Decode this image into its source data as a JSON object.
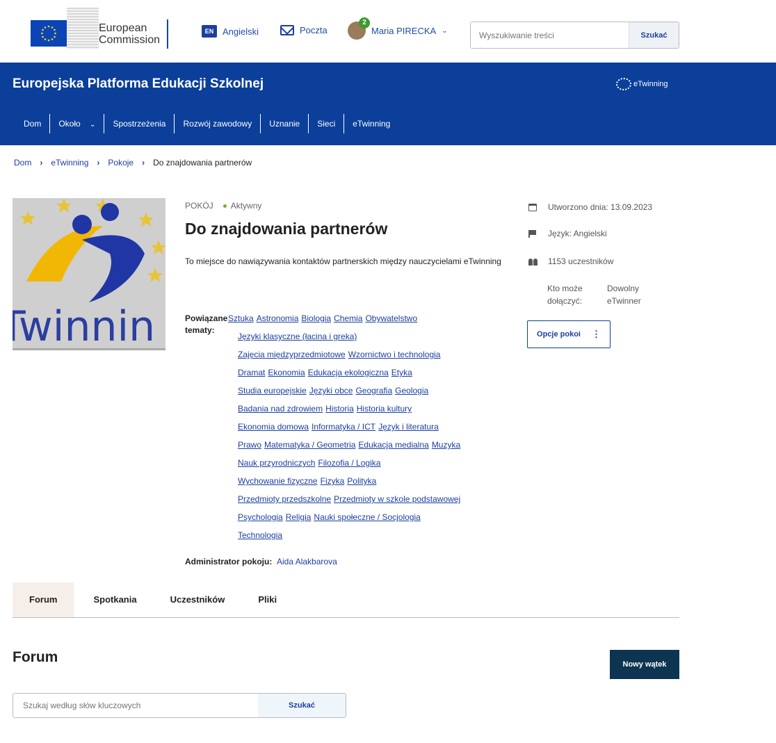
{
  "header": {
    "logo_text_line1": "European",
    "logo_text_line2": "Commission",
    "language_code": "EN",
    "language_label": "Angielski",
    "mail_label": "Poczta",
    "notification_count": "2",
    "user_name": "Maria PIRECKA",
    "search_placeholder": "Wyszukiwanie treści",
    "search_button": "Szukać"
  },
  "site": {
    "title": "Europejska Platforma Edukacji Szkolnej",
    "brand": "eTwinning",
    "nav": [
      "Dom",
      "Około",
      "Spostrzeżenia",
      "Rozwój zawodowy",
      "Uznanie",
      "Sieci",
      "eTwinning"
    ]
  },
  "breadcrumb": [
    "Dom",
    "eTwinning",
    "Pokoje",
    "Do znajdowania partnerów"
  ],
  "room": {
    "image_text": "Twinnin",
    "kind": "POKÓJ",
    "status": "Aktywny",
    "title": "Do znajdowania partnerów",
    "description": "To miejsce do nawiązywania kontaktów partnerskich między nauczycielami eTwinning",
    "topics_label": "Powiązane tematy:",
    "topics_rows": [
      [
        "Sztuka",
        "Astronomia",
        "Biologia",
        "Chemia",
        "Obywatelstwo"
      ],
      [
        "Języki klasyczne (łacina i greka)"
      ],
      [
        "Zajęcia międzyprzedmiotowe",
        "Wzornictwo i technologia"
      ],
      [
        "Dramat",
        "Ekonomia",
        "Edukacja ekologiczna",
        "Etyka"
      ],
      [
        "Studia europejskie",
        "Języki obce",
        "Geografia",
        "Geologia"
      ],
      [
        "Badania nad zdrowiem",
        "Historia",
        "Historia kultury"
      ],
      [
        "Ekonomia domowa",
        "Informatyka / ICT",
        "Język i literatura"
      ],
      [
        "Prawo",
        "Matematyka / Geometria",
        "Edukacja medialna",
        "Muzyka"
      ],
      [
        "Nauk przyrodniczych",
        "Filozofia / Logika"
      ],
      [
        "Wychowanie fizyczne",
        "Fizyka",
        "Polityka"
      ],
      [
        "Przedmioty przedszkolne",
        "Przedmioty w szkole podstawowej"
      ],
      [
        "Psychologia",
        "Religia",
        "Nauki społeczne / Socjologia"
      ],
      [
        "Technologia"
      ]
    ],
    "admin_label": "Administrator pokoju:",
    "admin_name": "Aida Alakbarova",
    "created": "Utworzono dnia: 13.09.2023",
    "language": "Język: Angielski",
    "participants": "1153 uczestników",
    "join_label_1": "Kto może",
    "join_label_2": "dołączyć:",
    "join_value_1": "Dowolny",
    "join_value_2": "eTwinner",
    "options_button": "Opcje pokoi"
  },
  "tabs": [
    "Forum",
    "Spotkania",
    "Uczestników",
    "Pliki"
  ],
  "forum": {
    "heading": "Forum",
    "new_thread": "Nowy wątek",
    "search_placeholder": "Szukaj według słów kluczowych",
    "search_button": "Szukać"
  }
}
